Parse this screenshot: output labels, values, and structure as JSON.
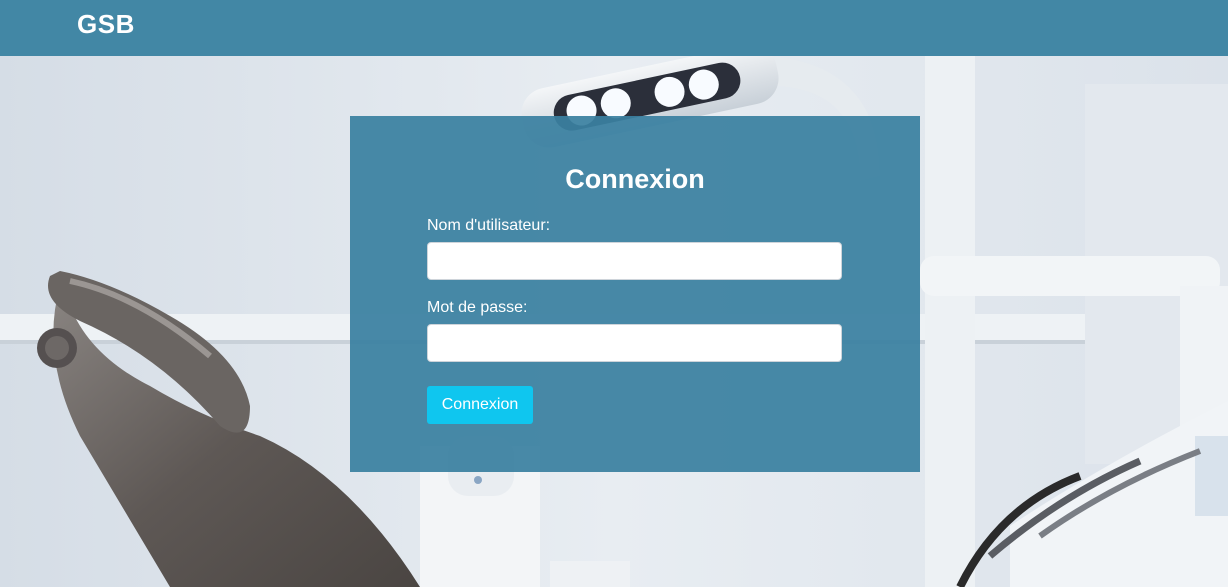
{
  "navbar": {
    "brand": "GSB"
  },
  "login": {
    "title": "Connexion",
    "username_label": "Nom d'utilisateur:",
    "username_value": "",
    "password_label": "Mot de passe:",
    "password_value": "",
    "submit_label": "Connexion"
  },
  "colors": {
    "navbar": "#4287a5",
    "panel": "#3a80a0",
    "button": "#0fc6ef"
  }
}
